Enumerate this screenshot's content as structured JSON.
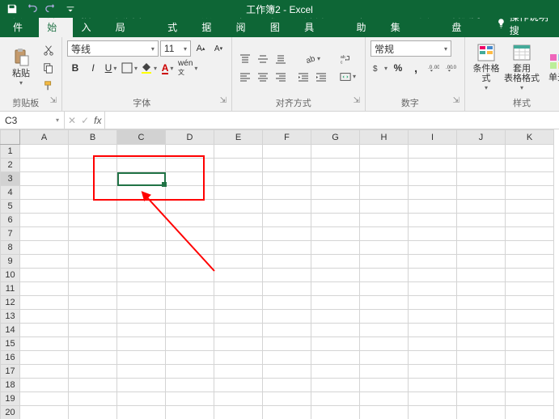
{
  "title": "工作簿2 - Excel",
  "tabs": [
    "文件",
    "开始",
    "插入",
    "页面布局",
    "公式",
    "数据",
    "审阅",
    "视图",
    "开发工具",
    "帮助",
    "PDF工具集",
    "百度网盘"
  ],
  "active_tab_index": 1,
  "tell_me": "操作说明搜",
  "font": {
    "name": "等线",
    "size": "11"
  },
  "number_format": "常规",
  "groups": {
    "clipboard": "剪贴板",
    "font": "字体",
    "align": "对齐方式",
    "number": "数字",
    "styles": "样式"
  },
  "paste_label": "粘贴",
  "cond_fmt_label": "条件格式",
  "table_fmt_label": "套用\n表格格式",
  "cell_style_label": "单元",
  "columns": [
    "A",
    "B",
    "C",
    "D",
    "E",
    "F",
    "G",
    "H",
    "I",
    "J",
    "K"
  ],
  "row_count": 20,
  "name_box": "C3",
  "formula": "",
  "selected": {
    "col": "C",
    "row": 3
  }
}
